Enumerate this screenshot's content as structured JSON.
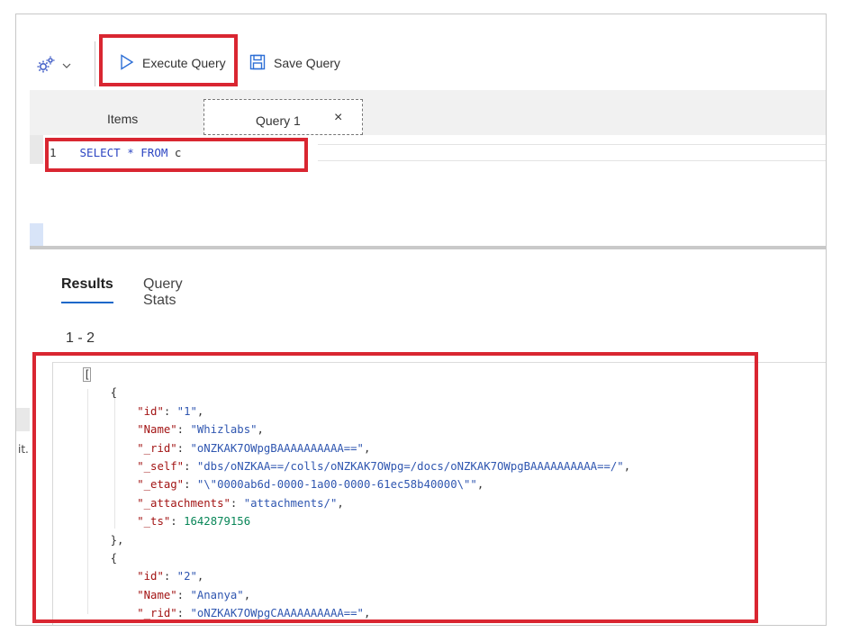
{
  "toolbar": {
    "execute_label": "Execute Query",
    "save_label": "Save Query"
  },
  "tabs": {
    "items_label": "Items",
    "query_label": "Query 1",
    "close_glyph": "×"
  },
  "editor": {
    "line_number": "1",
    "kw_select": "SELECT",
    "star": "*",
    "kw_from": "FROM",
    "alias": "c"
  },
  "results": {
    "tab_results": "Results",
    "tab_stats": "Query Stats",
    "count": "1 - 2",
    "edge_text": "it."
  },
  "json_lines": [
    [
      {
        "t": "p",
        "v": "["
      }
    ],
    [
      {
        "t": "p",
        "v": "    {"
      }
    ],
    [
      {
        "t": "p",
        "v": "        "
      },
      {
        "t": "k",
        "v": "\"id\""
      },
      {
        "t": "p",
        "v": ": "
      },
      {
        "t": "s",
        "v": "\"1\""
      },
      {
        "t": "p",
        "v": ","
      }
    ],
    [
      {
        "t": "p",
        "v": "        "
      },
      {
        "t": "k",
        "v": "\"Name\""
      },
      {
        "t": "p",
        "v": ": "
      },
      {
        "t": "s",
        "v": "\"Whizlabs\""
      },
      {
        "t": "p",
        "v": ","
      }
    ],
    [
      {
        "t": "p",
        "v": "        "
      },
      {
        "t": "k",
        "v": "\"_rid\""
      },
      {
        "t": "p",
        "v": ": "
      },
      {
        "t": "s",
        "v": "\"oNZKAK7OWpgBAAAAAAAAAA==\""
      },
      {
        "t": "p",
        "v": ","
      }
    ],
    [
      {
        "t": "p",
        "v": "        "
      },
      {
        "t": "k",
        "v": "\"_self\""
      },
      {
        "t": "p",
        "v": ": "
      },
      {
        "t": "s",
        "v": "\"dbs/oNZKAA==/colls/oNZKAK7OWpg=/docs/oNZKAK7OWpgBAAAAAAAAAA==/\""
      },
      {
        "t": "p",
        "v": ","
      }
    ],
    [
      {
        "t": "p",
        "v": "        "
      },
      {
        "t": "k",
        "v": "\"_etag\""
      },
      {
        "t": "p",
        "v": ": "
      },
      {
        "t": "s",
        "v": "\"\\\"0000ab6d-0000-1a00-0000-61ec58b40000\\\"\""
      },
      {
        "t": "p",
        "v": ","
      }
    ],
    [
      {
        "t": "p",
        "v": "        "
      },
      {
        "t": "k",
        "v": "\"_attachments\""
      },
      {
        "t": "p",
        "v": ": "
      },
      {
        "t": "s",
        "v": "\"attachments/\""
      },
      {
        "t": "p",
        "v": ","
      }
    ],
    [
      {
        "t": "p",
        "v": "        "
      },
      {
        "t": "k",
        "v": "\"_ts\""
      },
      {
        "t": "p",
        "v": ": "
      },
      {
        "t": "n",
        "v": "1642879156"
      }
    ],
    [
      {
        "t": "p",
        "v": "    },"
      }
    ],
    [
      {
        "t": "p",
        "v": "    {"
      }
    ],
    [
      {
        "t": "p",
        "v": "        "
      },
      {
        "t": "k",
        "v": "\"id\""
      },
      {
        "t": "p",
        "v": ": "
      },
      {
        "t": "s",
        "v": "\"2\""
      },
      {
        "t": "p",
        "v": ","
      }
    ],
    [
      {
        "t": "p",
        "v": "        "
      },
      {
        "t": "k",
        "v": "\"Name\""
      },
      {
        "t": "p",
        "v": ": "
      },
      {
        "t": "s",
        "v": "\"Ananya\""
      },
      {
        "t": "p",
        "v": ","
      }
    ],
    [
      {
        "t": "p",
        "v": "        "
      },
      {
        "t": "k",
        "v": "\"_rid\""
      },
      {
        "t": "p",
        "v": ": "
      },
      {
        "t": "s",
        "v": "\"oNZKAK7OWpgCAAAAAAAAAA==\""
      },
      {
        "t": "p",
        "v": ","
      }
    ]
  ],
  "colors": {
    "highlight": "#d92631",
    "accent": "#1a68c9",
    "json_key": "#a31515",
    "json_string": "#2f56b0",
    "json_number": "#098658"
  },
  "icons": {
    "settings": "gear-icon",
    "execute": "play-icon",
    "save": "floppy-disk-icon",
    "close": "close-icon"
  }
}
